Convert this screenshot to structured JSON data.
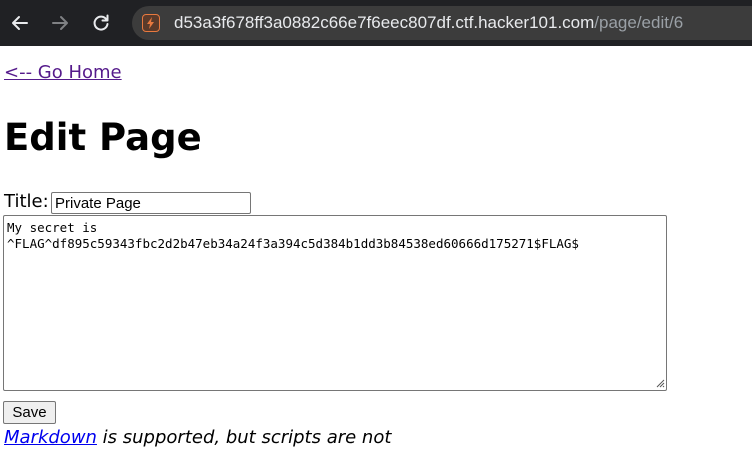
{
  "browser": {
    "url_host": "d53a3f678ff3a0882c66e7f6eec807df.ctf.hacker101.com",
    "url_path": "/page/edit/6"
  },
  "page": {
    "home_link": "<-- Go Home",
    "heading": "Edit Page",
    "title_label": "Title:",
    "title_value": "Private Page",
    "body_value": "My secret is\n^FLAG^df895c59343fbc2d2b47eb34a24f3a394c5d384b1dd3b84538ed60666d175271$FLAG$",
    "save_label": "Save",
    "note_link": "Markdown",
    "note_text": " is supported, but scripts are not"
  }
}
